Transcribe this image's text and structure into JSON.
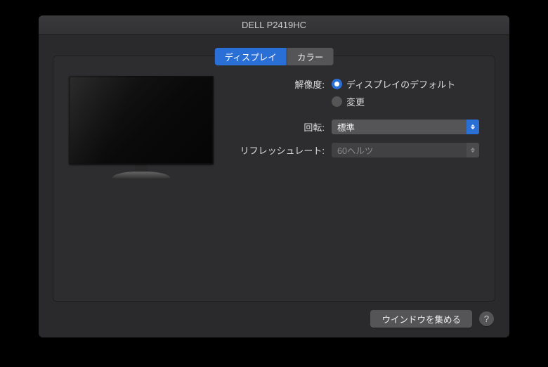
{
  "window": {
    "title": "DELL P2419HC"
  },
  "tabs": {
    "display": "ディスプレイ",
    "color": "カラー"
  },
  "settings": {
    "resolution_label": "解像度:",
    "resolution_default": "ディスプレイのデフォルト",
    "resolution_scaled": "変更",
    "rotation_label": "回転:",
    "rotation_value": "標準",
    "refresh_label": "リフレッシュレート:",
    "refresh_value": "60ヘルツ"
  },
  "footer": {
    "gather_windows": "ウインドウを集める",
    "help": "?"
  }
}
